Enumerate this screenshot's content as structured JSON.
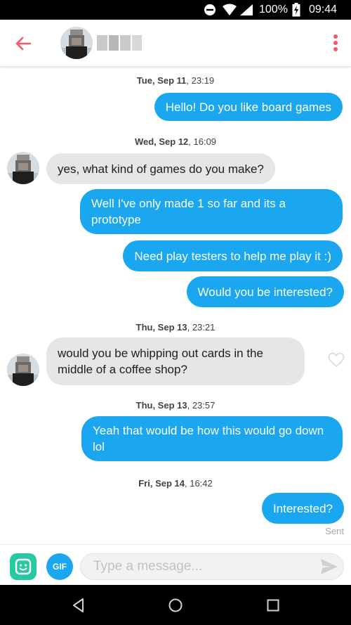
{
  "status_bar": {
    "battery_percent": "100%",
    "time": "09:44",
    "icons": [
      "do-not-disturb-icon",
      "wifi-icon",
      "signal-icon",
      "battery-charging-icon"
    ]
  },
  "header": {
    "back_icon": "back-arrow-icon",
    "menu_icon": "more-vertical-icon",
    "accent_color": "#f5576c"
  },
  "messages": [
    {
      "timestamp_day": "Tue, Sep 11",
      "timestamp_time": ", 23:19"
    },
    {
      "direction": "out",
      "text": "Hello! Do you like board games"
    },
    {
      "timestamp_day": "Wed, Sep 12",
      "timestamp_time": ", 16:09"
    },
    {
      "direction": "in",
      "text": "yes, what kind of games do you make?"
    },
    {
      "direction": "out",
      "text": "Well I've only made 1 so far and its a prototype"
    },
    {
      "direction": "out",
      "text": "Need play testers to help me play it :)"
    },
    {
      "direction": "out",
      "text": "Would you be interested?"
    },
    {
      "timestamp_day": "Thu, Sep 13",
      "timestamp_time": ", 23:21"
    },
    {
      "direction": "in",
      "text": "would you be whipping out cards in the middle of a coffee shop?"
    },
    {
      "timestamp_day": "Thu, Sep 13",
      "timestamp_time": ", 23:57"
    },
    {
      "direction": "out",
      "text": "Yeah that would be how this would go down lol"
    },
    {
      "timestamp_day": "Fri, Sep 14",
      "timestamp_time": ", 16:42"
    },
    {
      "direction": "out",
      "text": "Interested?"
    }
  ],
  "sent_label": "Sent",
  "composer": {
    "gif_label": "GIF",
    "placeholder": "Type a message...",
    "value": ""
  },
  "colors": {
    "outgoing_bubble": "#1aa7f0",
    "incoming_bubble": "#e6e6e6",
    "sticker_button": "#27c9a3"
  }
}
